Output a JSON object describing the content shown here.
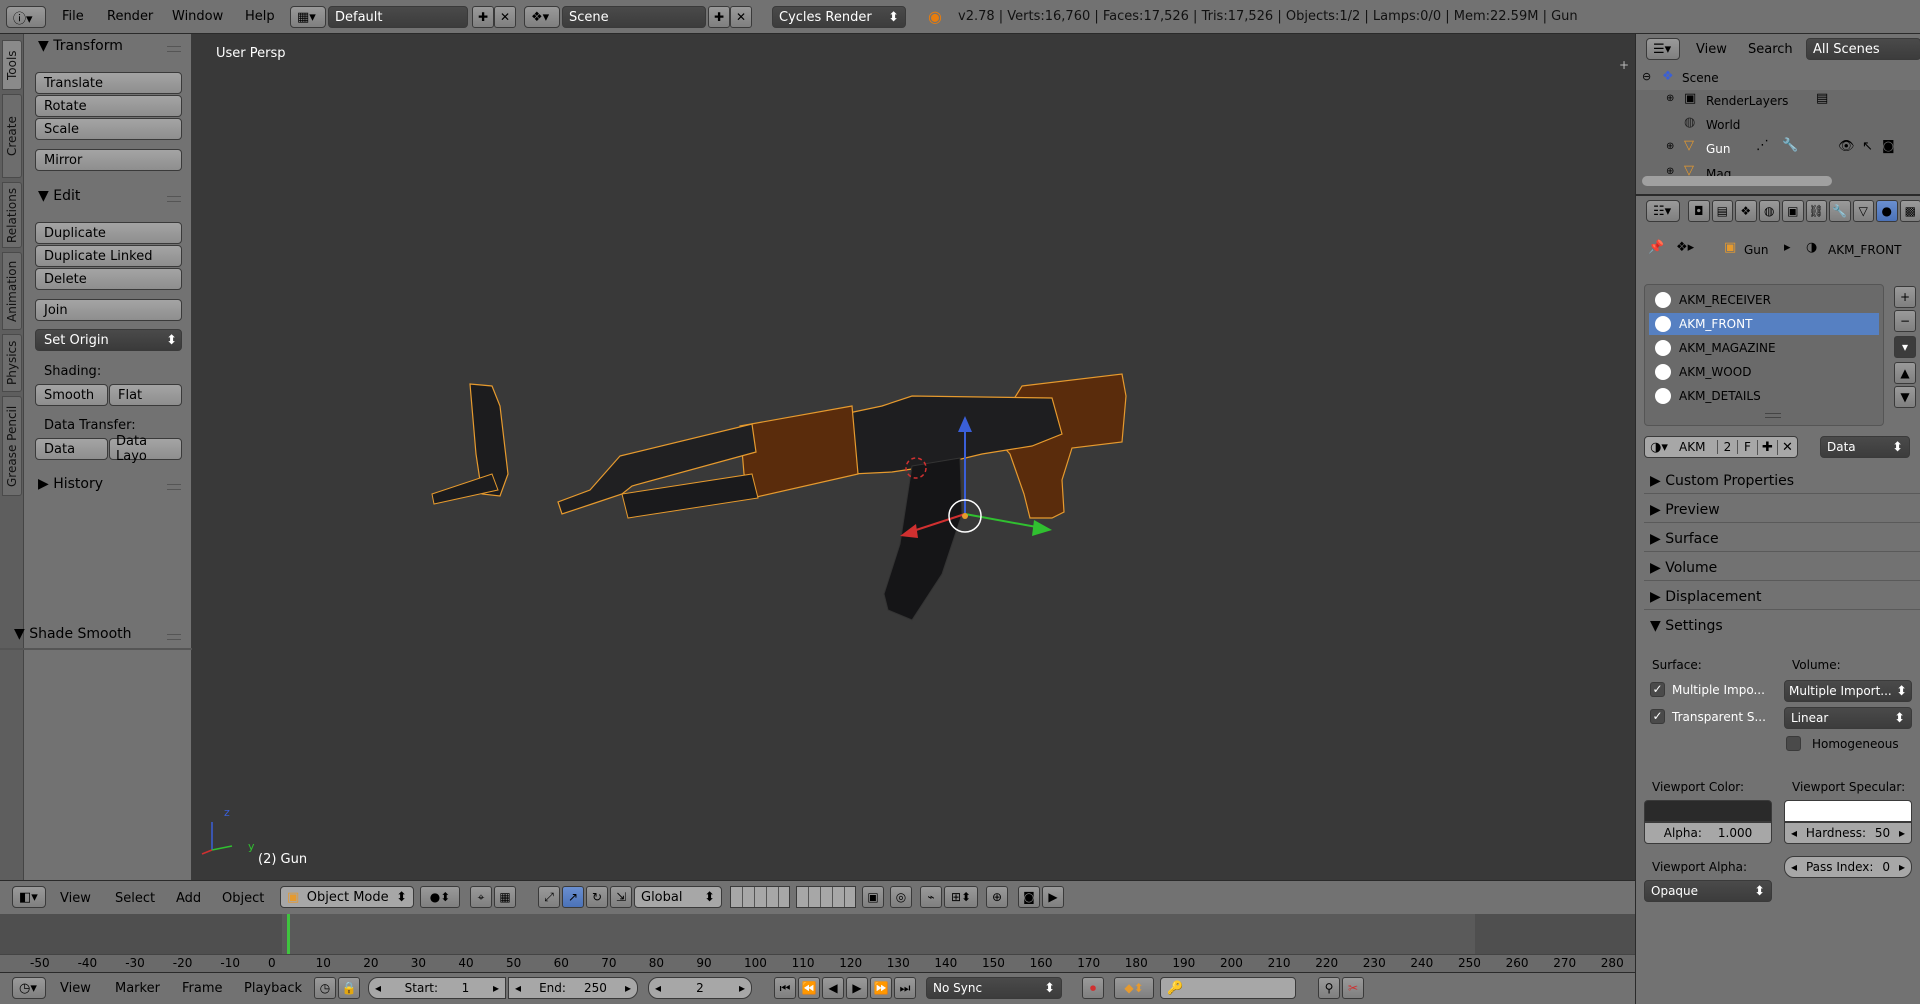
{
  "topbar": {
    "menus": [
      "File",
      "Render",
      "Window",
      "Help"
    ],
    "screen_layout": "Default",
    "scene": "Scene",
    "render_engine": "Cycles Render",
    "stats": "v2.78 | Verts:16,760 | Faces:17,526 | Tris:17,526 | Objects:1/2 | Lamps:0/0 | Mem:22.59M | Gun"
  },
  "tabs": [
    "Tools",
    "Create",
    "Relations",
    "Animation",
    "Physics",
    "Grease Pencil"
  ],
  "toolshelf": {
    "transform_header": "Transform",
    "translate": "Translate",
    "rotate": "Rotate",
    "scale": "Scale",
    "mirror": "Mirror",
    "edit_header": "Edit",
    "duplicate": "Duplicate",
    "duplicate_linked": "Duplicate Linked",
    "delete": "Delete",
    "join": "Join",
    "set_origin": "Set Origin",
    "shading_label": "Shading:",
    "smooth": "Smooth",
    "flat": "Flat",
    "data_transfer_label": "Data Transfer:",
    "data": "Data",
    "data_layo": "Data Layo",
    "history_header": "History",
    "operator_header": "Shade Smooth"
  },
  "viewport": {
    "view_name": "User Persp",
    "object_label": "(2) Gun",
    "axis_z": "z",
    "axis_y": "y",
    "axis_x": "x"
  },
  "outliner": {
    "menus": [
      "View",
      "Search"
    ],
    "filter": "All Scenes",
    "items": [
      "Scene",
      "RenderLayers",
      "World",
      "Gun",
      "Mag"
    ]
  },
  "properties": {
    "breadcrumb_object": "Gun",
    "breadcrumb_material": "AKM_FRONT",
    "materials": [
      "AKM_RECEIVER",
      "AKM_FRONT",
      "AKM_MAGAZINE",
      "AKM_WOOD",
      "AKM_DETAILS"
    ],
    "selected_material": "AKM_FRONT",
    "mat_name": "AKM",
    "mat_users": "2",
    "mat_fake": "F",
    "link": "Data",
    "sections": [
      "Custom Properties",
      "Preview",
      "Surface",
      "Volume",
      "Displacement"
    ],
    "settings_header": "Settings",
    "surface_label": "Surface:",
    "volume_label": "Volume:",
    "multiple_importance": "Multiple Impo...",
    "volume_sampling": "Multiple Import...",
    "transparent_shadows": "Transparent S...",
    "interpolation": "Linear",
    "homogeneous": "Homogeneous",
    "viewport_color_label": "Viewport Color:",
    "viewport_specular_label": "Viewport Specular:",
    "alpha_label": "Alpha:",
    "alpha_value": "1.000",
    "hardness_label": "Hardness:",
    "hardness_value": "50",
    "viewport_alpha_label": "Viewport Alpha:",
    "pass_index_label": "Pass Index:",
    "pass_index_value": "0",
    "blend_mode": "Opaque"
  },
  "viewport_header": {
    "menus": [
      "View",
      "Select",
      "Add",
      "Object"
    ],
    "mode": "Object Mode",
    "orientation": "Global"
  },
  "timeline": {
    "ticks": [
      "-50",
      "-40",
      "-30",
      "-20",
      "-10",
      "0",
      "10",
      "20",
      "30",
      "40",
      "50",
      "60",
      "70",
      "80",
      "90",
      "100",
      "110",
      "120",
      "130",
      "140",
      "150",
      "160",
      "170",
      "180",
      "190",
      "200",
      "210",
      "220",
      "230",
      "240",
      "250",
      "260",
      "270",
      "280"
    ],
    "menus": [
      "View",
      "Marker",
      "Frame",
      "Playback"
    ],
    "start_label": "Start:",
    "start_value": "1",
    "end_label": "End:",
    "end_value": "250",
    "current_frame": "2",
    "sync": "No Sync"
  },
  "colors": {
    "accent_blue": "#5680c2",
    "selection_outline": "#e69a2e",
    "viewport_bg": "#393939",
    "panel_bg": "#727272"
  }
}
